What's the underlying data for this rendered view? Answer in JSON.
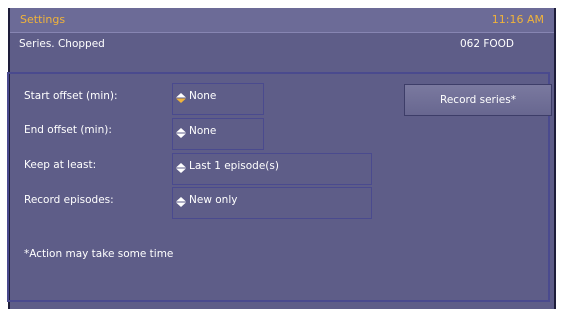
{
  "header": {
    "title": "Settings",
    "time": "11:16 AM"
  },
  "info": {
    "series": "Series. Chopped",
    "channel": "062 FOOD"
  },
  "settings": [
    {
      "label": "Start offset (min):",
      "value": "None"
    },
    {
      "label": "End offset (min):",
      "value": "None"
    },
    {
      "label": "Keep at least:",
      "value": "Last 1 episode(s)"
    },
    {
      "label": "Record episodes:",
      "value": "New only"
    }
  ],
  "record_button": {
    "label": "Record series*"
  },
  "footnote": "*Action may take some time",
  "colors": {
    "accent": "#f0b33a",
    "background": "#5e5d88",
    "border": "#4a4a8e"
  }
}
